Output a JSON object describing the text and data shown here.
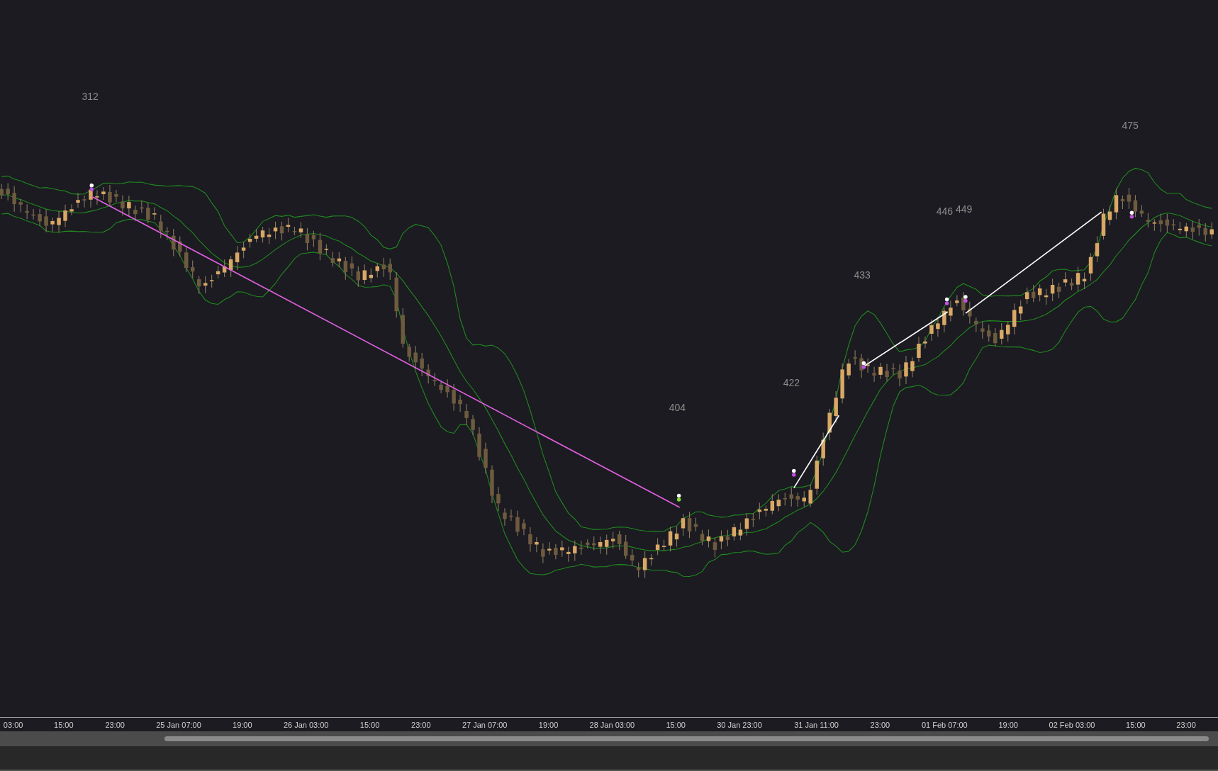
{
  "price_labels": [
    "312",
    "475",
    "446",
    "449",
    "433",
    "422",
    "404"
  ],
  "time_axis": [
    "03:00",
    "15:00",
    "23:00",
    "25 Jan 07:00",
    "19:00",
    "26 Jan 03:00",
    "15:00",
    "23:00",
    "27 Jan 07:00",
    "19:00",
    "28 Jan 03:00",
    "15:00",
    "30 Jan 23:00",
    "31 Jan 11:00",
    "23:00",
    "01 Feb 07:00",
    "19:00",
    "02 Feb 03:00",
    "15:00",
    "23:00"
  ]
}
